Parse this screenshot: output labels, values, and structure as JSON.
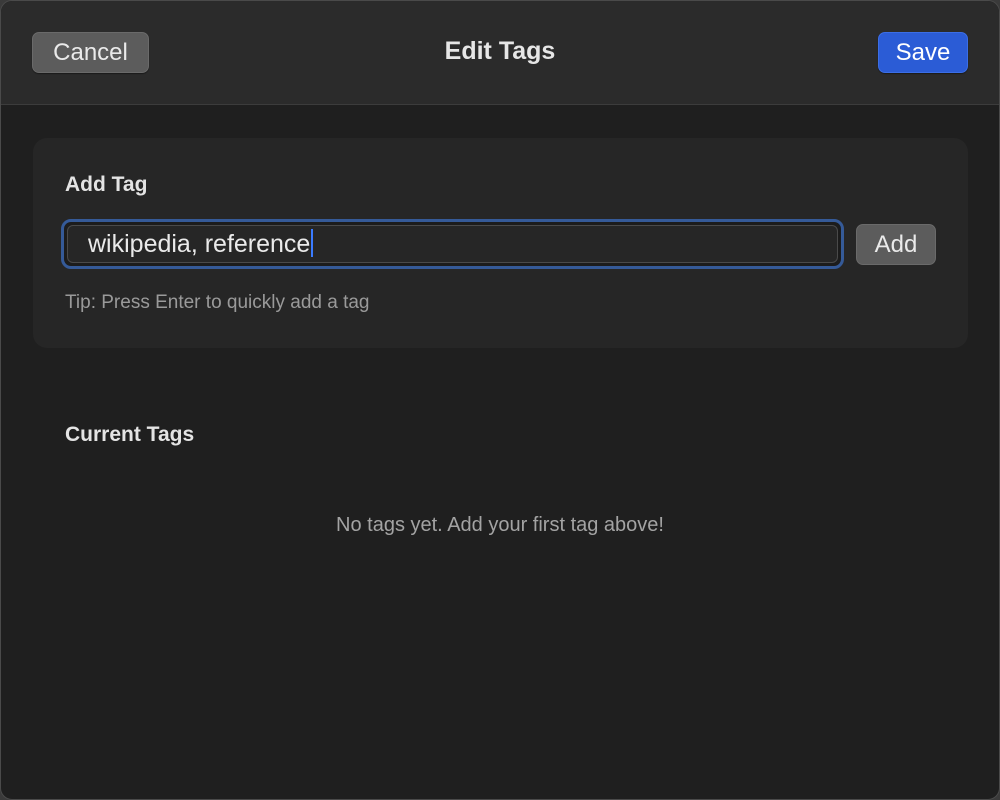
{
  "window": {
    "title": "Edit Tags"
  },
  "toolbar": {
    "cancel_label": "Cancel",
    "save_label": "Save"
  },
  "add_tag": {
    "section_label": "Add Tag",
    "input_value": "wikipedia, reference",
    "add_button_label": "Add",
    "tip": "Tip: Press Enter to quickly add a tag"
  },
  "current_tags": {
    "section_label": "Current Tags",
    "tags": [],
    "empty_message": "No tags yet. Add your first tag above!"
  },
  "colors": {
    "accent": "#2b5cd6",
    "focus_ring": "#355a98",
    "background": "#1f1f1f"
  }
}
